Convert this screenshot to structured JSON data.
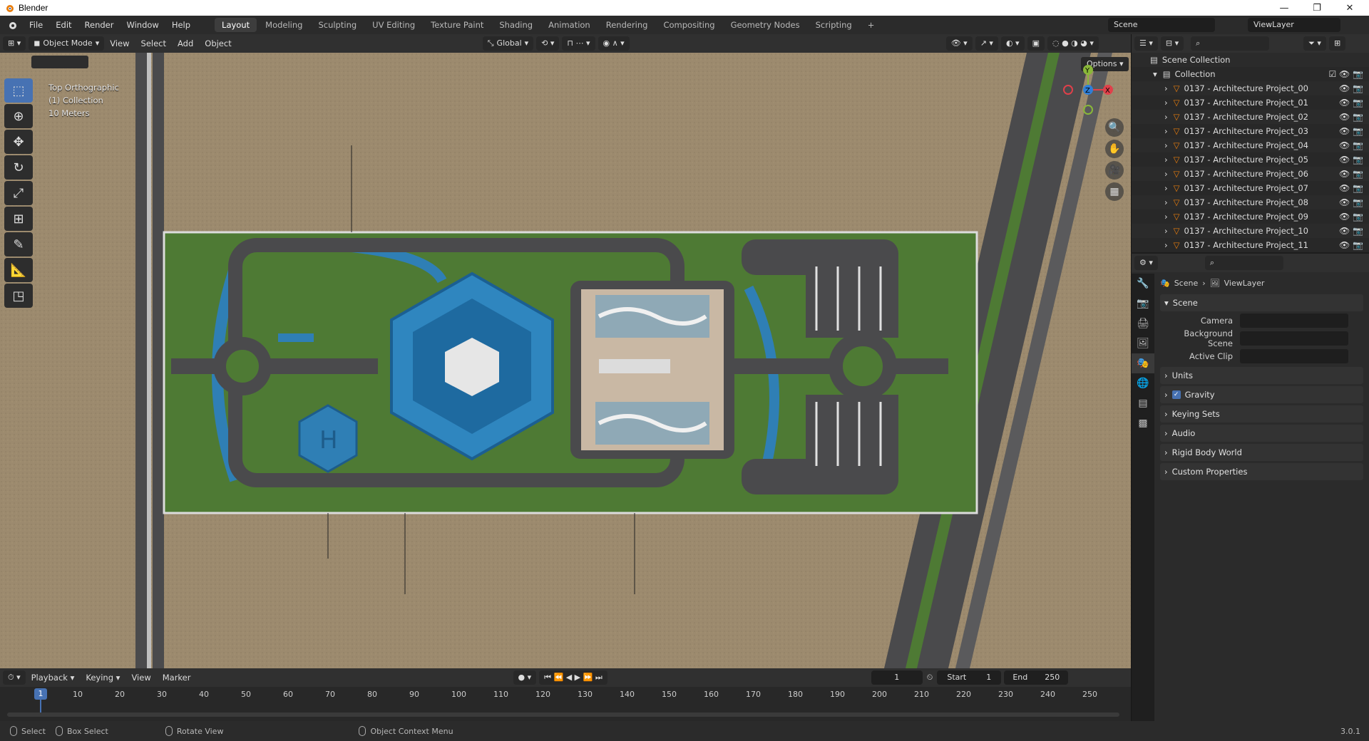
{
  "window": {
    "title": "Blender",
    "version": "3.0.1"
  },
  "menu": [
    "File",
    "Edit",
    "Render",
    "Window",
    "Help"
  ],
  "workspaces": [
    "Layout",
    "Modeling",
    "Sculpting",
    "UV Editing",
    "Texture Paint",
    "Shading",
    "Animation",
    "Rendering",
    "Compositing",
    "Geometry Nodes",
    "Scripting"
  ],
  "active_workspace": "Layout",
  "scene_name": "Scene",
  "view_layer": "ViewLayer",
  "header3d": {
    "mode": "Object Mode",
    "view": "View",
    "select": "Select",
    "add": "Add",
    "object": "Object",
    "orientation": "Global"
  },
  "viewport": {
    "projection": "Top Orthographic",
    "collection": "(1) Collection",
    "scale": "10 Meters",
    "options": "Options"
  },
  "outliner": {
    "scene_collection": "Scene Collection",
    "collection": "Collection",
    "items": [
      "0137 - Architecture Project_00",
      "0137 - Architecture Project_01",
      "0137 - Architecture Project_02",
      "0137 - Architecture Project_03",
      "0137 - Architecture Project_04",
      "0137 - Architecture Project_05",
      "0137 - Architecture Project_06",
      "0137 - Architecture Project_07",
      "0137 - Architecture Project_08",
      "0137 - Architecture Project_09",
      "0137 - Architecture Project_10",
      "0137 - Architecture Project_11"
    ]
  },
  "properties": {
    "breadcrumb_scene": "Scene",
    "breadcrumb_layer": "ViewLayer",
    "panel_scene": "Scene",
    "camera_label": "Camera",
    "bg_scene_label": "Background Scene",
    "active_clip_label": "Active Clip",
    "panels": [
      "Units",
      "Gravity",
      "Keying Sets",
      "Audio",
      "Rigid Body World",
      "Custom Properties"
    ]
  },
  "timeline": {
    "playback": "Playback",
    "keying": "Keying",
    "view": "View",
    "marker": "Marker",
    "current_frame": "1",
    "start_label": "Start",
    "start": "1",
    "end_label": "End",
    "end": "250",
    "ticks": [
      "10",
      "20",
      "30",
      "40",
      "50",
      "60",
      "70",
      "80",
      "90",
      "100",
      "110",
      "120",
      "130",
      "140",
      "150",
      "160",
      "170",
      "180",
      "190",
      "200",
      "210",
      "220",
      "230",
      "240",
      "250"
    ]
  },
  "status": {
    "select": "Select",
    "box_select": "Box Select",
    "rotate_view": "Rotate View",
    "context_menu": "Object Context Menu"
  },
  "colors": {
    "accent": "#4772b3",
    "ground": "#9c8a6e",
    "grass": "#4e7a34",
    "road": "#4a4a4c",
    "water": "#2f7fb5"
  }
}
